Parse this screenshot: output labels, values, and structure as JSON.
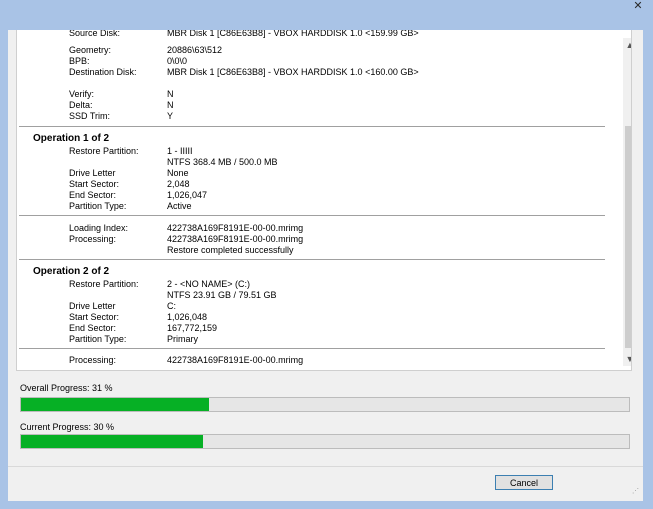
{
  "window": {
    "close_glyph": "✕"
  },
  "log": {
    "source_disk_label": "Source Disk:",
    "source_disk_value": "MBR Disk 1 [C86E63B8] - VBOX HARDDISK 1.0  <159.99 GB>",
    "geometry_label": "Geometry:",
    "geometry_value": "20886\\63\\512",
    "bpb_label": "BPB:",
    "bpb_value": "0\\0\\0",
    "destination_disk_label": "Destination Disk:",
    "destination_disk_value": "MBR Disk 1 [C86E63B8] - VBOX HARDDISK 1.0  <160.00 GB>",
    "verify_label": "Verify:",
    "verify_value": "N",
    "delta_label": "Delta:",
    "delta_value": "N",
    "ssd_trim_label": "SSD Trim:",
    "ssd_trim_value": "Y",
    "operations": [
      {
        "heading": "Operation 1 of 2",
        "restore_partition_label": "Restore Partition:",
        "restore_partition_value": "1 - IIIII",
        "restore_partition_detail": "NTFS 368.4 MB / 500.0 MB",
        "drive_letter_label": "Drive Letter",
        "drive_letter_value": "None",
        "start_sector_label": "Start Sector:",
        "start_sector_value": "2,048",
        "end_sector_label": "End Sector:",
        "end_sector_value": "1,026,047",
        "partition_type_label": "Partition Type:",
        "partition_type_value": "Active",
        "loading_index_label": "Loading Index:",
        "loading_index_value": "422738A169F8191E-00-00.mrimg",
        "processing_label": "Processing:",
        "processing_value": "422738A169F8191E-00-00.mrimg",
        "result": "Restore completed successfully"
      },
      {
        "heading": "Operation 2 of 2",
        "restore_partition_label": "Restore Partition:",
        "restore_partition_value": "2 - <NO NAME> (C:)",
        "restore_partition_detail": "NTFS 23.91 GB / 79.51 GB",
        "drive_letter_label": "Drive Letter",
        "drive_letter_value": "C:",
        "start_sector_label": "Start Sector:",
        "start_sector_value": "1,026,048",
        "end_sector_label": "End Sector:",
        "end_sector_value": "167,772,159",
        "partition_type_label": "Partition Type:",
        "partition_type_value": "Primary",
        "processing_label": "Processing:",
        "processing_value": "422738A169F8191E-00-00.mrimg"
      }
    ]
  },
  "progress": {
    "overall_label": "Overall Progress:  31 %",
    "overall_fraction": 0.31,
    "current_label": "Current Progress:  30 %",
    "current_fraction": 0.3,
    "fill_color": "#06b025"
  },
  "buttons": {
    "cancel_label": "Cancel"
  },
  "icons": {
    "scroll_up": "chevron-up-icon",
    "scroll_down": "chevron-down-icon",
    "resize_grip": "resize-grip-icon"
  }
}
